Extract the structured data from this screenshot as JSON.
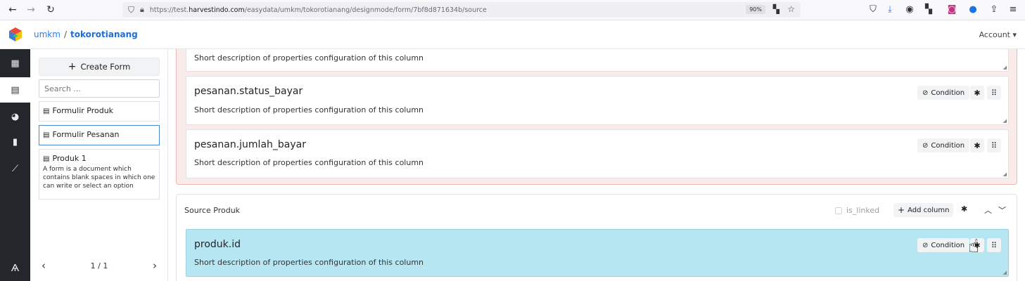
{
  "browser": {
    "url_prefix": "https://test.",
    "url_domain": "harvestindo.com",
    "url_path": "/easydata/umkm/tokorotianang/designmode/form/7bf8d871634b/source",
    "zoom": "90%"
  },
  "app": {
    "breadcrumb_org": "umkm",
    "breadcrumb_sep": "/",
    "breadcrumb_app": "tokorotianang",
    "account_label": "Account ▾"
  },
  "sidebar": {
    "create_label": "Create Form",
    "search_placeholder": "Search ...",
    "forms": [
      {
        "title": "Formulir Produk",
        "desc": ""
      },
      {
        "title": "Formulir Pesanan",
        "desc": ""
      },
      {
        "title": "Produk 1",
        "desc": "A form is a document which contains blank spaces in which one can write or select an option"
      }
    ],
    "pager": {
      "prev": "‹",
      "label": "1 / 1",
      "next": "›"
    }
  },
  "columns": {
    "desc": "Short description of properties configuration of this column",
    "condition_label": "Condition",
    "items": [
      {
        "name": "pesanan.status_bayar"
      },
      {
        "name": "pesanan.jumlah_bayar"
      }
    ]
  },
  "source": {
    "title": "Source Produk",
    "linked_label": "is_linked",
    "add_column_label": "Add column",
    "columns": [
      {
        "name": "produk.id"
      }
    ]
  },
  "colors": {
    "accent": "#2b7de9",
    "highlight": "#b7e6f3",
    "pink_group": "#fbecec"
  }
}
